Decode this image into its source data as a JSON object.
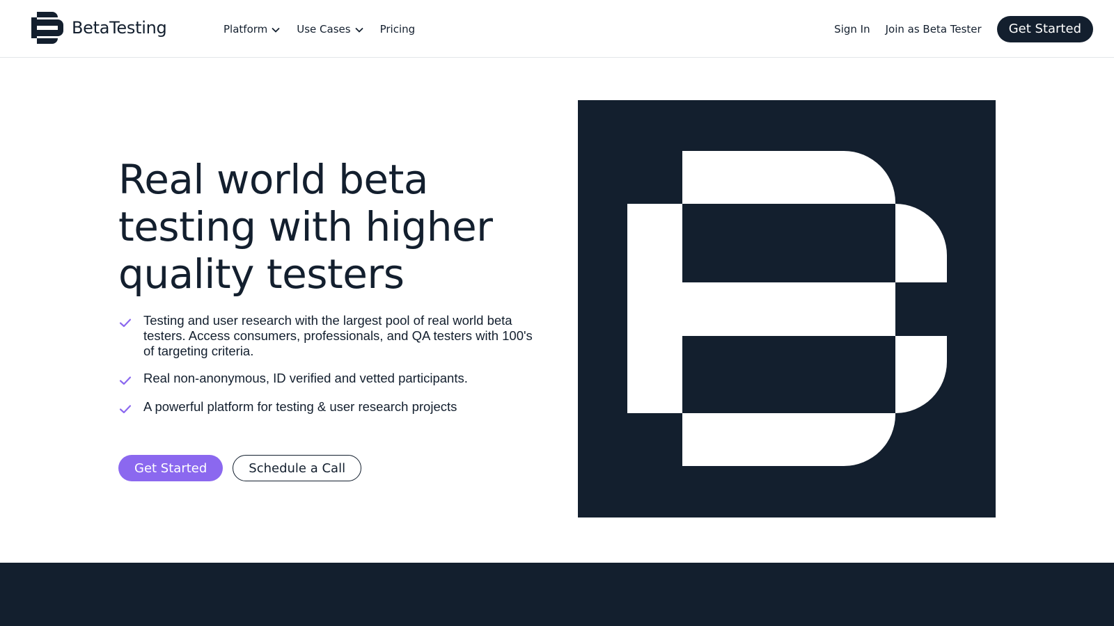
{
  "brand": {
    "name": "BetaTesting",
    "logo_icon": "b-logo-icon",
    "dark_color": "#131f2e",
    "accent_color": "#8b68ef"
  },
  "nav": {
    "items": [
      {
        "label": "Platform",
        "has_dropdown": true
      },
      {
        "label": "Use Cases",
        "has_dropdown": true
      },
      {
        "label": "Pricing",
        "has_dropdown": false
      }
    ],
    "sign_in": "Sign In",
    "join": "Join as Beta Tester",
    "get_started": "Get Started"
  },
  "hero": {
    "title_lines": [
      "Real world beta",
      "testing with higher",
      "quality testers"
    ],
    "bullets": [
      "Testing and user research with the largest pool of real world beta testers. Access consumers, professionals, and QA testers with 100's of targeting criteria.",
      "Real non-anonymous, ID verified and vetted participants.",
      "A powerful platform for testing & user research projects"
    ],
    "bullet_icon": "check-icon",
    "primary_cta": "Get Started",
    "secondary_cta": "Schedule a Call",
    "art_icon": "b-logo-graphic"
  }
}
